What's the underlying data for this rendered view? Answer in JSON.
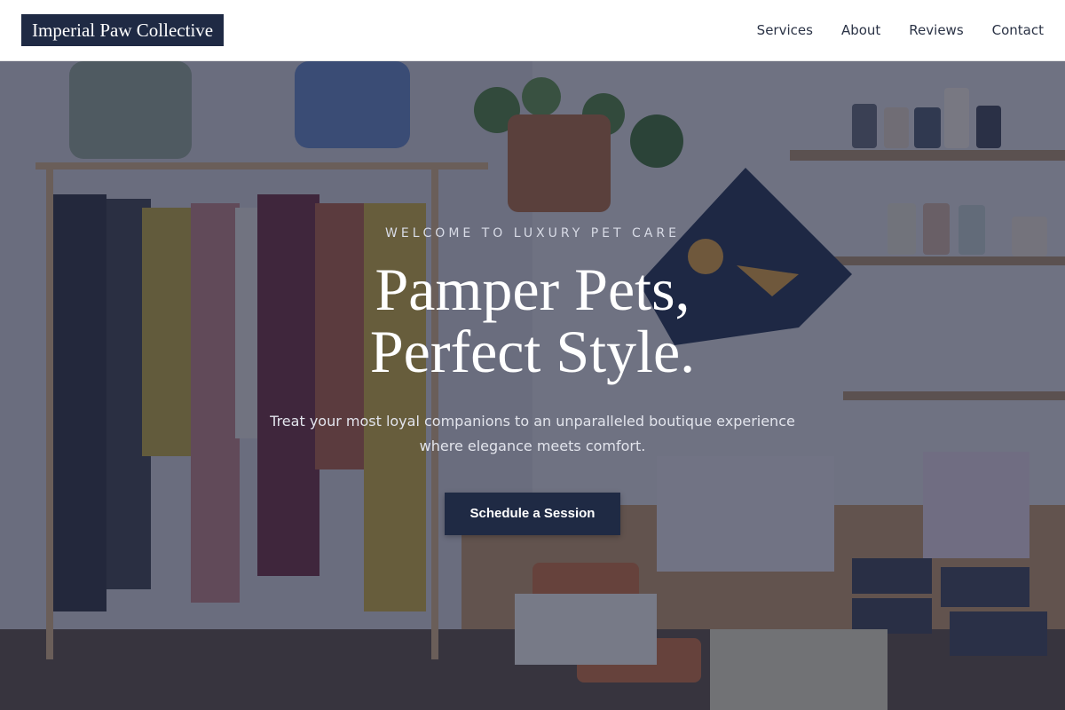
{
  "header": {
    "logo": "Imperial Paw Collective",
    "nav": [
      {
        "label": "Services"
      },
      {
        "label": "About"
      },
      {
        "label": "Reviews"
      },
      {
        "label": "Contact"
      }
    ]
  },
  "hero": {
    "eyebrow": "WELCOME TO LUXURY PET CARE",
    "headline_line1": "Pamper Pets,",
    "headline_line2": "Perfect Style.",
    "subtext": "Treat your most loyal companions to an unparalleled boutique experience where elegance meets comfort.",
    "cta_label": "Schedule a Session"
  },
  "colors": {
    "brand_navy": "#1f2a44",
    "overlay": "#1c223e",
    "header_bg": "#ffffff",
    "nav_text": "#2b3346"
  }
}
